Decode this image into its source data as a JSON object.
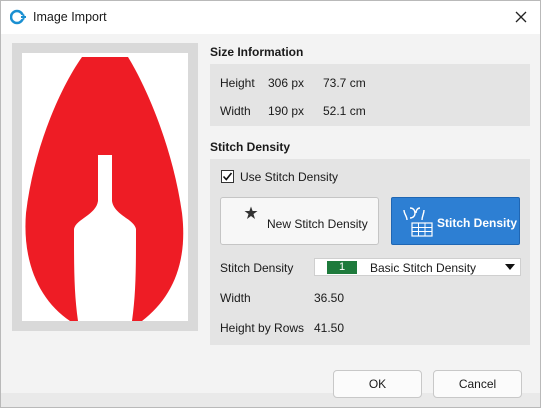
{
  "window": {
    "title": "Image Import"
  },
  "size_info": {
    "heading": "Size Information",
    "height_label": "Height",
    "height_px": "306 px",
    "height_cm": "73.7 cm",
    "width_label": "Width",
    "width_px": "190 px",
    "width_cm": "52.1 cm"
  },
  "stitch_density": {
    "heading": "Stitch Density",
    "use_label": "Use Stitch Density",
    "use_checked": true,
    "new_button": "New Stitch Density",
    "stitch_button": "Stitch Density",
    "select_label": "Stitch Density",
    "select_number": "1",
    "select_value": "Basic Stitch Density",
    "width_label": "Width",
    "width_value": "36.50",
    "height_rows_label": "Height by Rows",
    "height_rows_value": "41.50"
  },
  "footer": {
    "ok": "OK",
    "cancel": "Cancel"
  },
  "colors": {
    "preview_red": "#ee1c25",
    "accent_blue": "#2d7fd3",
    "badge_green": "#1e7a3c"
  },
  "icons": [
    "app-icon",
    "close-icon",
    "star-icon",
    "stitch-density-icon",
    "chevron-down-icon"
  ]
}
